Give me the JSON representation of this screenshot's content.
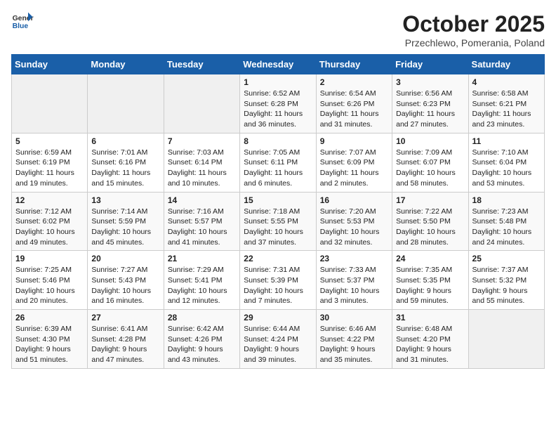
{
  "header": {
    "logo_general": "General",
    "logo_blue": "Blue",
    "month_title": "October 2025",
    "subtitle": "Przechlewo, Pomerania, Poland"
  },
  "weekdays": [
    "Sunday",
    "Monday",
    "Tuesday",
    "Wednesday",
    "Thursday",
    "Friday",
    "Saturday"
  ],
  "weeks": [
    [
      {
        "day": "",
        "content": ""
      },
      {
        "day": "",
        "content": ""
      },
      {
        "day": "",
        "content": ""
      },
      {
        "day": "1",
        "content": "Sunrise: 6:52 AM\nSunset: 6:28 PM\nDaylight: 11 hours\nand 36 minutes."
      },
      {
        "day": "2",
        "content": "Sunrise: 6:54 AM\nSunset: 6:26 PM\nDaylight: 11 hours\nand 31 minutes."
      },
      {
        "day": "3",
        "content": "Sunrise: 6:56 AM\nSunset: 6:23 PM\nDaylight: 11 hours\nand 27 minutes."
      },
      {
        "day": "4",
        "content": "Sunrise: 6:58 AM\nSunset: 6:21 PM\nDaylight: 11 hours\nand 23 minutes."
      }
    ],
    [
      {
        "day": "5",
        "content": "Sunrise: 6:59 AM\nSunset: 6:19 PM\nDaylight: 11 hours\nand 19 minutes."
      },
      {
        "day": "6",
        "content": "Sunrise: 7:01 AM\nSunset: 6:16 PM\nDaylight: 11 hours\nand 15 minutes."
      },
      {
        "day": "7",
        "content": "Sunrise: 7:03 AM\nSunset: 6:14 PM\nDaylight: 11 hours\nand 10 minutes."
      },
      {
        "day": "8",
        "content": "Sunrise: 7:05 AM\nSunset: 6:11 PM\nDaylight: 11 hours\nand 6 minutes."
      },
      {
        "day": "9",
        "content": "Sunrise: 7:07 AM\nSunset: 6:09 PM\nDaylight: 11 hours\nand 2 minutes."
      },
      {
        "day": "10",
        "content": "Sunrise: 7:09 AM\nSunset: 6:07 PM\nDaylight: 10 hours\nand 58 minutes."
      },
      {
        "day": "11",
        "content": "Sunrise: 7:10 AM\nSunset: 6:04 PM\nDaylight: 10 hours\nand 53 minutes."
      }
    ],
    [
      {
        "day": "12",
        "content": "Sunrise: 7:12 AM\nSunset: 6:02 PM\nDaylight: 10 hours\nand 49 minutes."
      },
      {
        "day": "13",
        "content": "Sunrise: 7:14 AM\nSunset: 5:59 PM\nDaylight: 10 hours\nand 45 minutes."
      },
      {
        "day": "14",
        "content": "Sunrise: 7:16 AM\nSunset: 5:57 PM\nDaylight: 10 hours\nand 41 minutes."
      },
      {
        "day": "15",
        "content": "Sunrise: 7:18 AM\nSunset: 5:55 PM\nDaylight: 10 hours\nand 37 minutes."
      },
      {
        "day": "16",
        "content": "Sunrise: 7:20 AM\nSunset: 5:53 PM\nDaylight: 10 hours\nand 32 minutes."
      },
      {
        "day": "17",
        "content": "Sunrise: 7:22 AM\nSunset: 5:50 PM\nDaylight: 10 hours\nand 28 minutes."
      },
      {
        "day": "18",
        "content": "Sunrise: 7:23 AM\nSunset: 5:48 PM\nDaylight: 10 hours\nand 24 minutes."
      }
    ],
    [
      {
        "day": "19",
        "content": "Sunrise: 7:25 AM\nSunset: 5:46 PM\nDaylight: 10 hours\nand 20 minutes."
      },
      {
        "day": "20",
        "content": "Sunrise: 7:27 AM\nSunset: 5:43 PM\nDaylight: 10 hours\nand 16 minutes."
      },
      {
        "day": "21",
        "content": "Sunrise: 7:29 AM\nSunset: 5:41 PM\nDaylight: 10 hours\nand 12 minutes."
      },
      {
        "day": "22",
        "content": "Sunrise: 7:31 AM\nSunset: 5:39 PM\nDaylight: 10 hours\nand 7 minutes."
      },
      {
        "day": "23",
        "content": "Sunrise: 7:33 AM\nSunset: 5:37 PM\nDaylight: 10 hours\nand 3 minutes."
      },
      {
        "day": "24",
        "content": "Sunrise: 7:35 AM\nSunset: 5:35 PM\nDaylight: 9 hours\nand 59 minutes."
      },
      {
        "day": "25",
        "content": "Sunrise: 7:37 AM\nSunset: 5:32 PM\nDaylight: 9 hours\nand 55 minutes."
      }
    ],
    [
      {
        "day": "26",
        "content": "Sunrise: 6:39 AM\nSunset: 4:30 PM\nDaylight: 9 hours\nand 51 minutes."
      },
      {
        "day": "27",
        "content": "Sunrise: 6:41 AM\nSunset: 4:28 PM\nDaylight: 9 hours\nand 47 minutes."
      },
      {
        "day": "28",
        "content": "Sunrise: 6:42 AM\nSunset: 4:26 PM\nDaylight: 9 hours\nand 43 minutes."
      },
      {
        "day": "29",
        "content": "Sunrise: 6:44 AM\nSunset: 4:24 PM\nDaylight: 9 hours\nand 39 minutes."
      },
      {
        "day": "30",
        "content": "Sunrise: 6:46 AM\nSunset: 4:22 PM\nDaylight: 9 hours\nand 35 minutes."
      },
      {
        "day": "31",
        "content": "Sunrise: 6:48 AM\nSunset: 4:20 PM\nDaylight: 9 hours\nand 31 minutes."
      },
      {
        "day": "",
        "content": ""
      }
    ]
  ]
}
